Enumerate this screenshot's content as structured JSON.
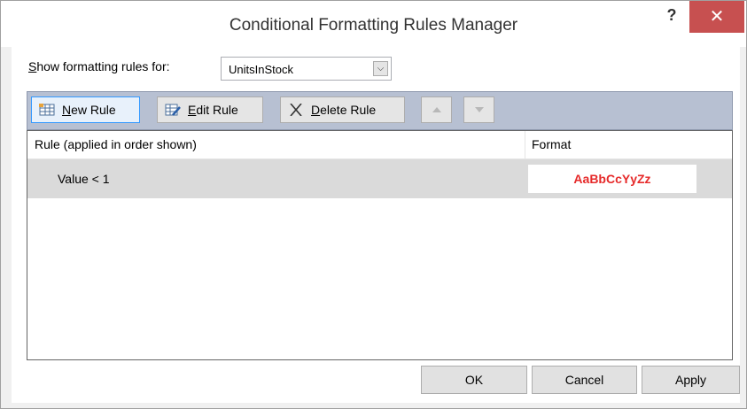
{
  "window": {
    "title": "Conditional Formatting Rules Manager",
    "help_glyph": "?",
    "close_glyph": "✕"
  },
  "scope": {
    "label_accel": "S",
    "label_rest": "how formatting rules for:",
    "selected": "UnitsInStock"
  },
  "toolbar": {
    "new_rule": {
      "accel": "N",
      "rest": "ew Rule"
    },
    "edit_rule": {
      "accel": "E",
      "rest": "dit Rule"
    },
    "delete_rule": {
      "accel": "D",
      "rest": "elete Rule"
    }
  },
  "grid": {
    "col_rule": "Rule (applied in order shown)",
    "col_format": "Format",
    "rows": [
      {
        "rule": "Value < 1",
        "format_preview": "AaBbCcYyZz",
        "format_color": "#e62a2a"
      }
    ]
  },
  "footer": {
    "ok": "OK",
    "cancel": "Cancel",
    "apply": "Apply"
  }
}
